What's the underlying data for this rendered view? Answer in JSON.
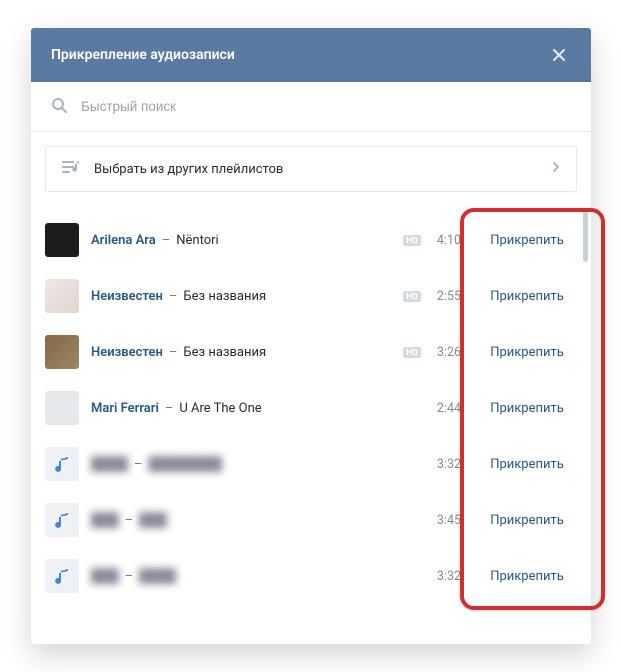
{
  "header": {
    "title": "Прикрепление аудиозаписи"
  },
  "search": {
    "placeholder": "Быстрый поиск"
  },
  "playlist_picker": {
    "label": "Выбрать из других плейлистов"
  },
  "hq_label": "HQ",
  "attach_label": "Прикрепить",
  "tracks": [
    {
      "artist": "Arilena Ara",
      "title": "Nëntori",
      "duration": "4:10",
      "hq": true
    },
    {
      "artist": "Неизвестен",
      "title": "Без названия",
      "duration": "2:55",
      "hq": true
    },
    {
      "artist": "Неизвестен",
      "title": "Без названия",
      "duration": "3:26",
      "hq": true
    },
    {
      "artist": "Mari Ferrari",
      "title": "U Are The One",
      "duration": "2:44",
      "hq": false
    },
    {
      "artist": "████",
      "title": "████████",
      "duration": "3:32",
      "hq": false
    },
    {
      "artist": "███",
      "title": "███",
      "duration": "3:45",
      "hq": false
    },
    {
      "artist": "███",
      "title": "████",
      "duration": "3:32",
      "hq": false
    }
  ]
}
